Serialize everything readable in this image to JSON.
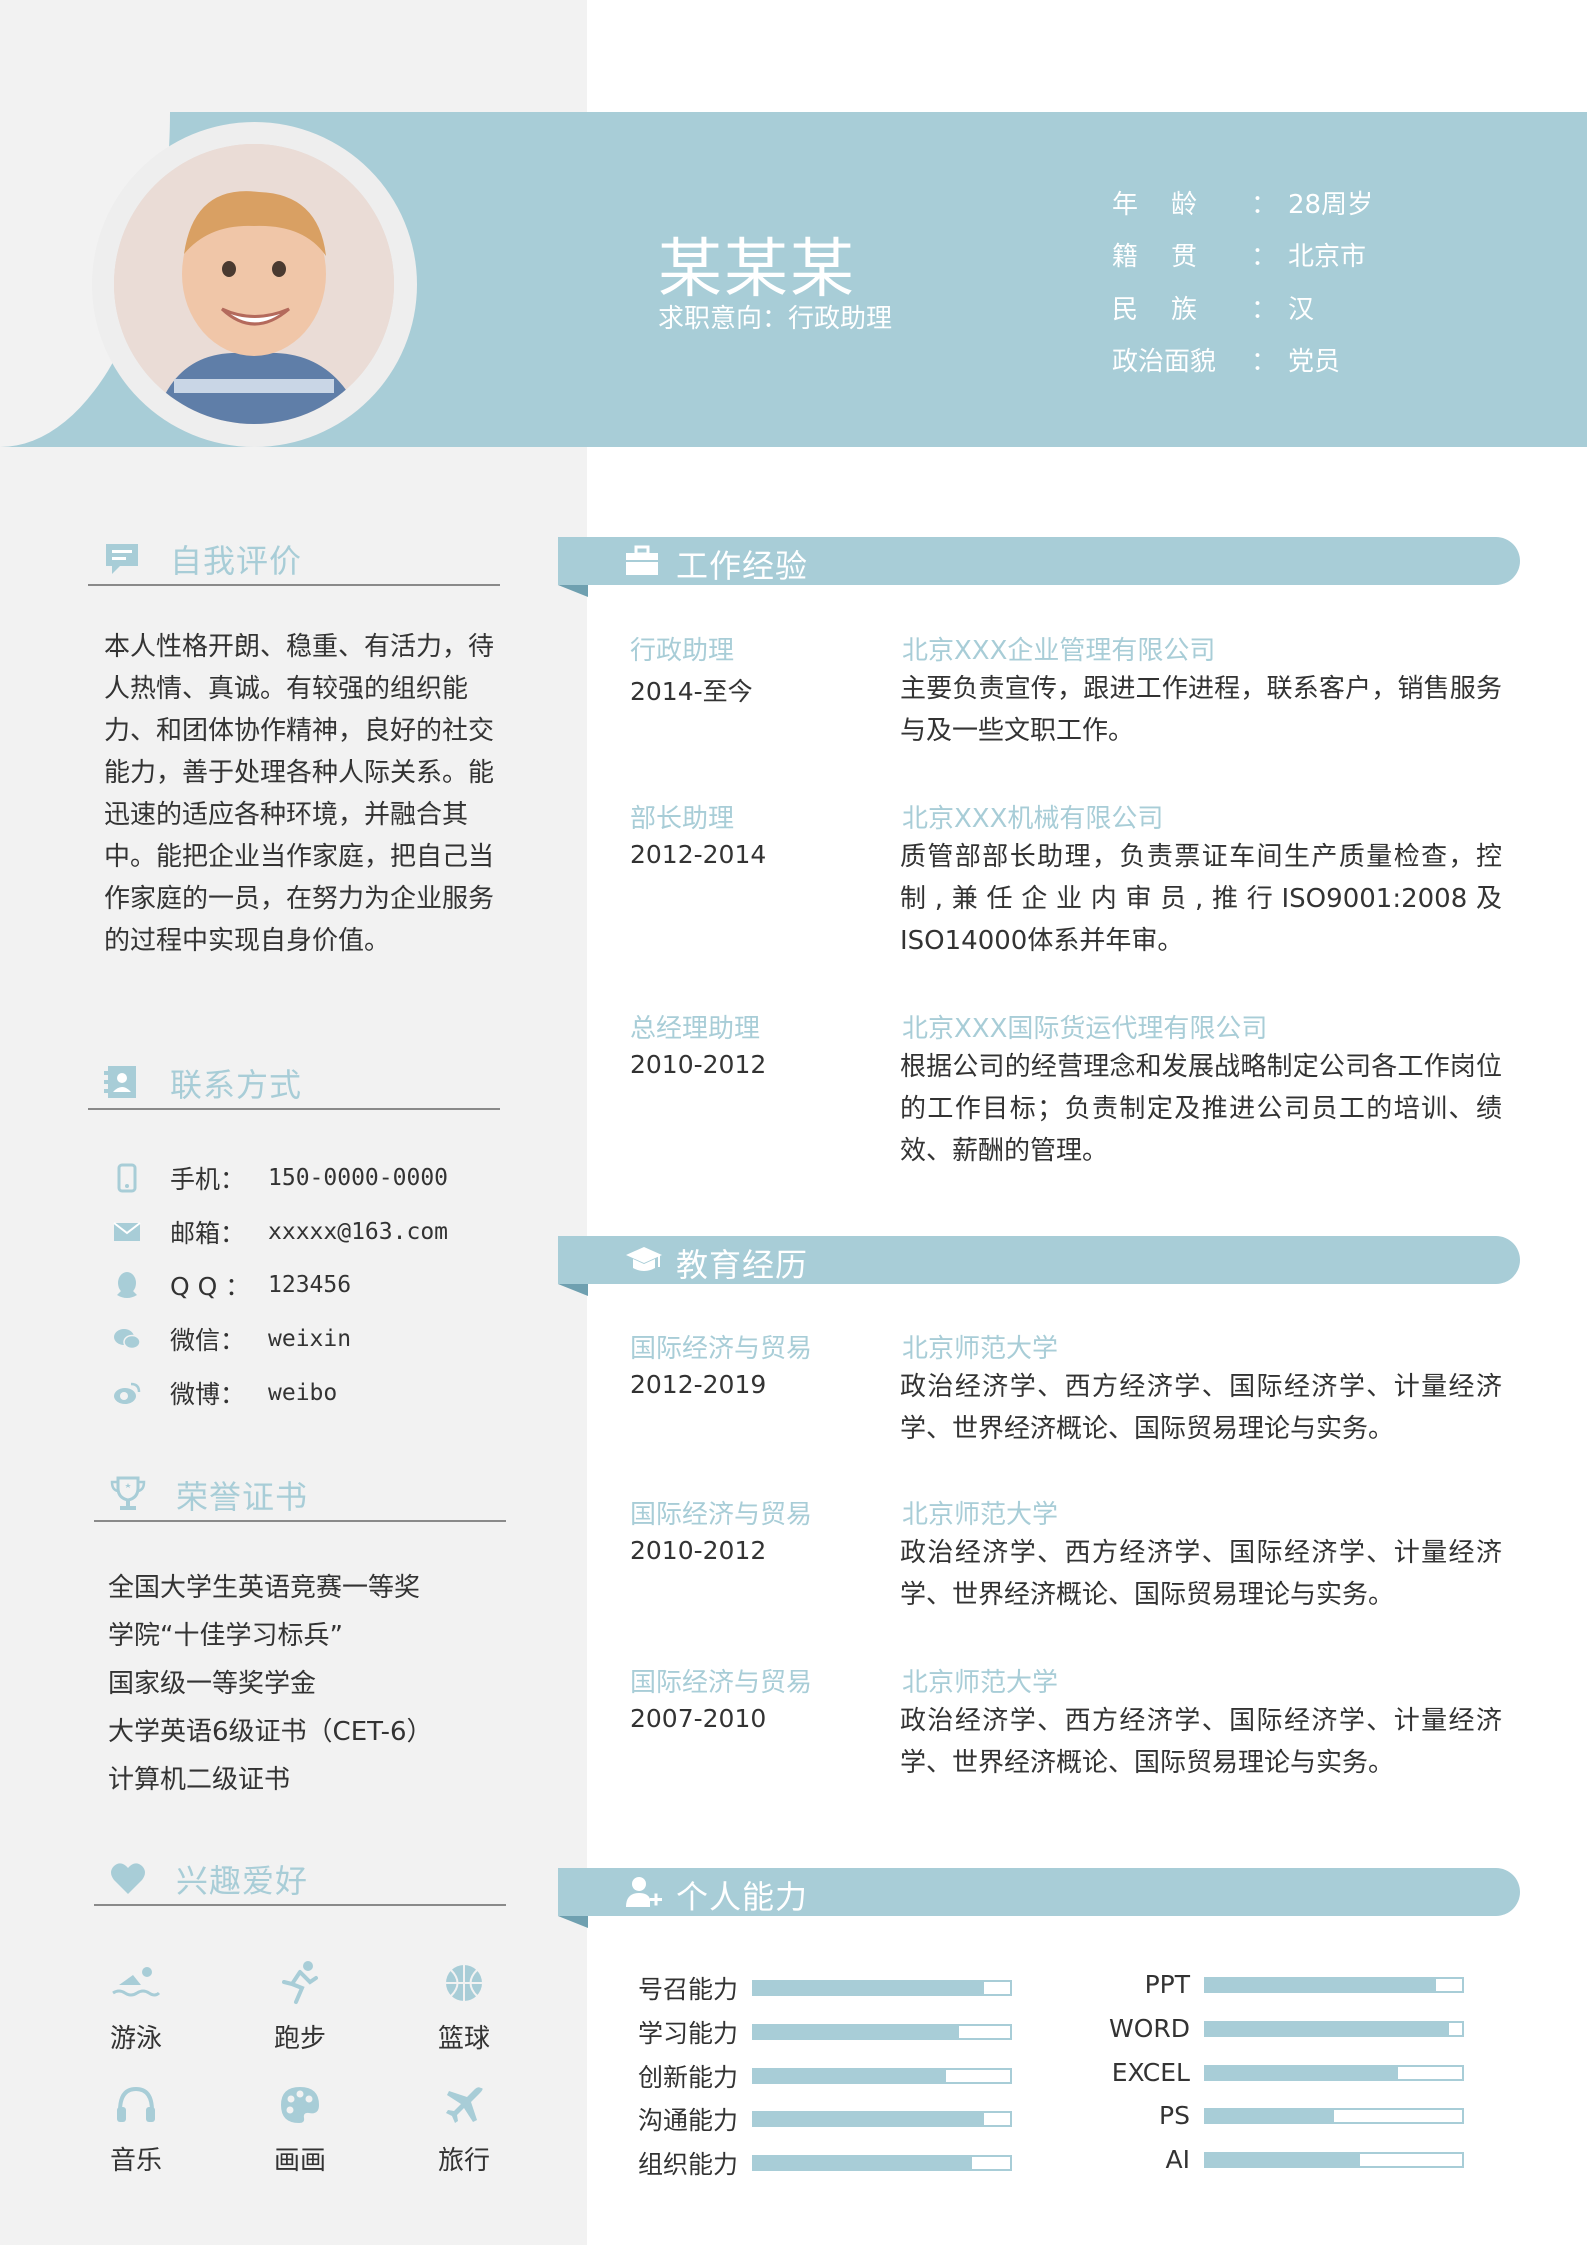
{
  "profile": {
    "name": "某某某",
    "intention": "求职意向：行政助理",
    "info": [
      {
        "label": "年    龄",
        "colon": "：",
        "value": "28周岁"
      },
      {
        "label": "籍    贯",
        "colon": "：",
        "value": "北京市"
      },
      {
        "label": "民    族",
        "colon": "：",
        "value": "汉"
      },
      {
        "label": "政治面貌",
        "colon": "：",
        "value": "党员"
      }
    ]
  },
  "sidebar": {
    "self_eval": {
      "title": "自我评价",
      "text": "本人性格开朗、稳重、有活力，待人热情、真诚。有较强的组织能力、和团体协作精神，良好的社交能力，善于处理各种人际关系。能迅速的适应各种环境，并融合其中。能把企业当作家庭，把自己当作家庭的一员，在努力为企业服务的过程中实现自身价值。"
    },
    "contact": {
      "title": "联系方式",
      "items": [
        {
          "label": "手机：",
          "value": "150-0000-0000"
        },
        {
          "label": "邮箱：",
          "value": "xxxxx@163.com"
        },
        {
          "label": "Q Q ：",
          "value": "123456"
        },
        {
          "label": "微信：",
          "value": "weixin"
        },
        {
          "label": "微博：",
          "value": "weibo"
        }
      ]
    },
    "honors": {
      "title": "荣誉证书",
      "items": [
        "全国大学生英语竞赛一等奖",
        "学院“十佳学习标兵”",
        "国家级一等奖学金",
        "大学英语6级证书（CET-6）",
        "计算机二级证书"
      ]
    },
    "hobbies": {
      "title": "兴趣爱好",
      "items": [
        "游泳",
        "跑步",
        "篮球",
        "音乐",
        "画画",
        "旅行"
      ]
    }
  },
  "work": {
    "title": "工作经验",
    "entries": [
      {
        "role": "行政助理",
        "date": "2014-至今",
        "org": "北京XXX企业管理有限公司",
        "desc": "主要负责宣传，跟进工作进程，联系客户，销售服务与及一些文职工作。"
      },
      {
        "role": "部长助理",
        "date": "2012-2014",
        "org": "北京XXX机械有限公司",
        "desc": "质管部部长助理，负责票证车间生产质量检查，控制,兼任企业内审员,推行ISO9001:2008及ISO14000体系并年审。"
      },
      {
        "role": "总经理助理",
        "date": "2010-2012",
        "org": "北京XXX国际货运代理有限公司",
        "desc": "根据公司的经营理念和发展战略制定公司各工作岗位的工作目标；负责制定及推进公司员工的培训、绩效、薪酬的管理。"
      }
    ]
  },
  "education": {
    "title": "教育经历",
    "entries": [
      {
        "major": "国际经济与贸易",
        "date": "2012-2019",
        "school": "北京师范大学",
        "desc": "政治经济学、西方经济学、国际经济学、计量经济学、世界经济概论、国际贸易理论与实务。"
      },
      {
        "major": "国际经济与贸易",
        "date": "2010-2012",
        "school": "北京师范大学",
        "desc": "政治经济学、西方经济学、国际经济学、计量经济学、世界经济概论、国际贸易理论与实务。"
      },
      {
        "major": "国际经济与贸易",
        "date": "2007-2010",
        "school": "北京师范大学",
        "desc": "政治经济学、西方经济学、国际经济学、计量经济学、世界经济概论、国际贸易理论与实务。"
      }
    ]
  },
  "skills": {
    "title": "个人能力",
    "left": [
      {
        "label": "号召能力",
        "level": 0.9
      },
      {
        "label": "学习能力",
        "level": 0.8
      },
      {
        "label": "创新能力",
        "level": 0.75
      },
      {
        "label": "沟通能力",
        "level": 0.9
      },
      {
        "label": "组织能力",
        "level": 0.85
      }
    ],
    "right": [
      {
        "label": "PPT",
        "level": 0.9
      },
      {
        "label": "WORD",
        "level": 0.95
      },
      {
        "label": "EXCEL",
        "level": 0.75
      },
      {
        "label": "PS",
        "level": 0.5
      },
      {
        "label": "AI",
        "level": 0.6
      }
    ]
  },
  "colors": {
    "accent": "#a8cdd7",
    "sidebar": "#f2f2f2",
    "text": "#333333"
  }
}
